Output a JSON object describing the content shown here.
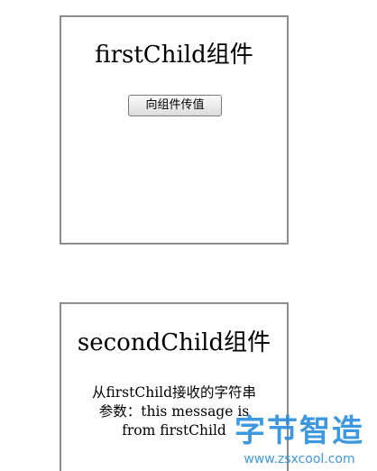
{
  "first_child": {
    "title": "firstChild组件",
    "send_button_label": "向组件传值"
  },
  "second_child": {
    "title": "secondChild组件",
    "received_lines": [
      "从firstChild接收的字符串",
      "参数：this message is",
      "from firstChild"
    ]
  },
  "watermark": {
    "logo_text": "字节智造",
    "url": "www.zsxcool.com",
    "color": "#2a8ddc"
  }
}
